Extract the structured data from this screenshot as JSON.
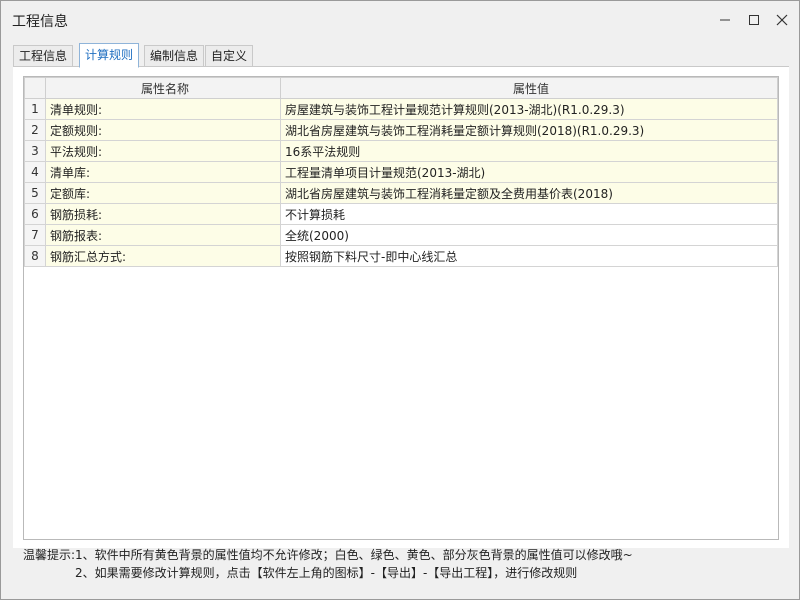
{
  "window": {
    "title": "工程信息",
    "controls": {
      "minimize": "—",
      "maximize": "☐",
      "close": "✕"
    }
  },
  "tabs": [
    {
      "label": "工程信息",
      "active": false
    },
    {
      "label": "计算规则",
      "active": true
    },
    {
      "label": "编制信息",
      "active": false
    },
    {
      "label": "自定义",
      "active": false
    }
  ],
  "table": {
    "headers": [
      "",
      "属性名称",
      "属性值"
    ],
    "rows": [
      {
        "n": "1",
        "name": "清单规则:",
        "value": "房屋建筑与装饰工程计量规范计算规则(2013-湖北)(R1.0.29.3)",
        "bg": "yellow"
      },
      {
        "n": "2",
        "name": "定额规则:",
        "value": "湖北省房屋建筑与装饰工程消耗量定额计算规则(2018)(R1.0.29.3)",
        "bg": "yellow"
      },
      {
        "n": "3",
        "name": "平法规则:",
        "value": "16系平法规则",
        "bg": "yellow"
      },
      {
        "n": "4",
        "name": "清单库:",
        "value": "工程量清单项目计量规范(2013-湖北)",
        "bg": "yellow"
      },
      {
        "n": "5",
        "name": "定额库:",
        "value": "湖北省房屋建筑与装饰工程消耗量定额及全费用基价表(2018)",
        "bg": "yellow"
      },
      {
        "n": "6",
        "name": "钢筋损耗:",
        "value": "不计算损耗",
        "bg": "white"
      },
      {
        "n": "7",
        "name": "钢筋报表:",
        "value": "全统(2000)",
        "bg": "white"
      },
      {
        "n": "8",
        "name": "钢筋汇总方式:",
        "value": "按照钢筋下料尺寸-即中心线汇总",
        "bg": "white"
      }
    ]
  },
  "hint": {
    "line1": "温馨提示:1、软件中所有黄色背景的属性值均不允许修改；白色、绿色、黄色、部分灰色背景的属性值可以修改哦~",
    "line2": "2、如果需要修改计算规则，点击【软件左上角的图标】-【导出】-【导出工程】，进行修改规则"
  },
  "colors": {
    "yellow_cell": "#fdfde7",
    "active_tab_text": "#1f6fc1"
  }
}
